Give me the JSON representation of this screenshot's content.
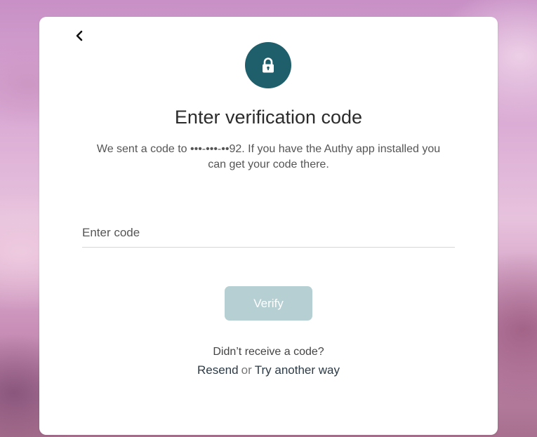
{
  "dialog": {
    "title": "Enter verification code",
    "description": "We sent a code to •••-•••-••92. If you have the Authy app installed you can get your code there.",
    "code_input": {
      "placeholder": "Enter code",
      "value": ""
    },
    "verify_label": "Verify",
    "help_prompt": "Didn’t receive a code?",
    "resend_label": "Resend",
    "or_label": "or",
    "try_another_label": "Try another way"
  },
  "icons": {
    "back": "chevron-left-icon",
    "lock": "lock-icon"
  },
  "colors": {
    "accent": "#1f5f6b",
    "verify_disabled": "#b5cfd2"
  }
}
